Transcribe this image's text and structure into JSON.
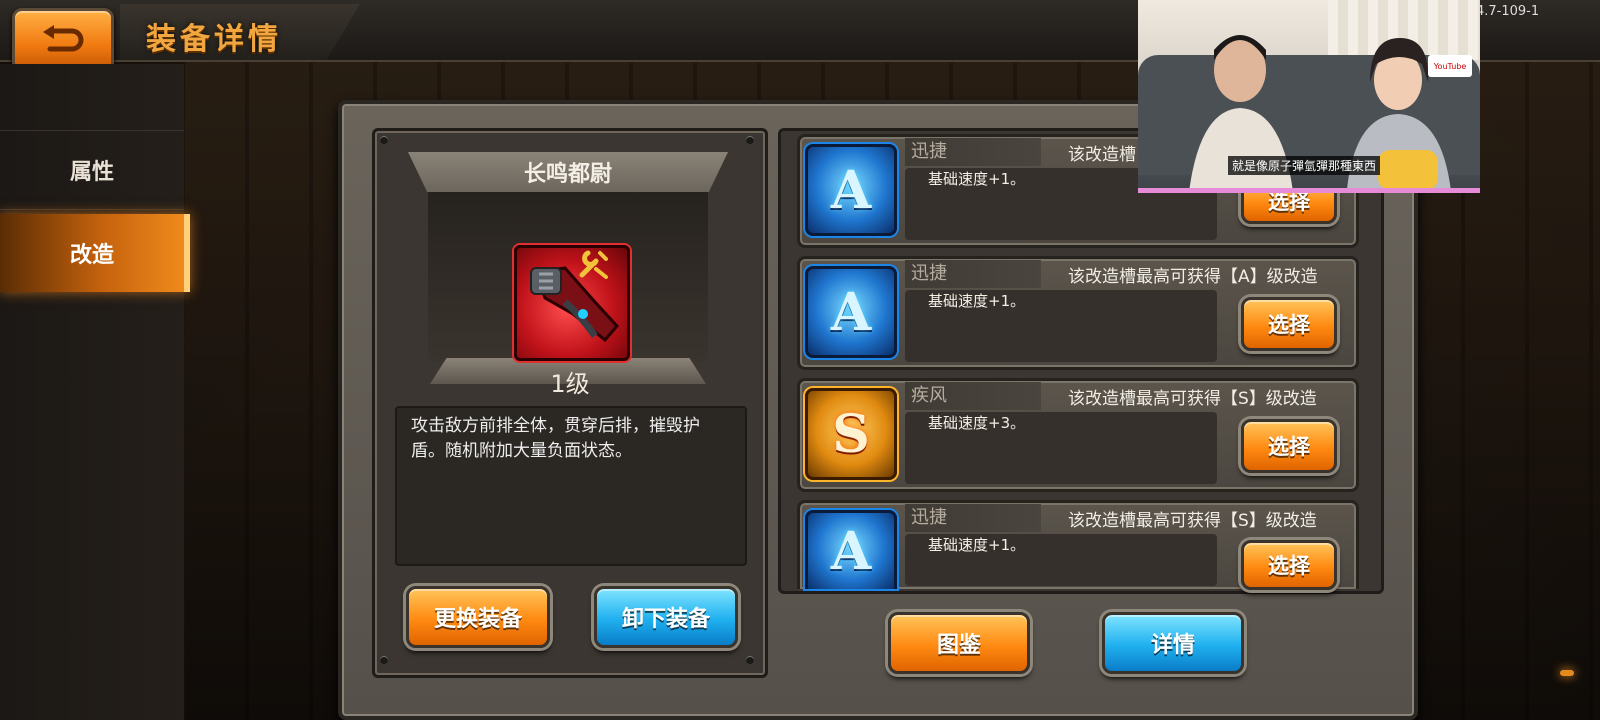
{
  "header": {
    "title": "装备详情",
    "version": "4.7-109-1"
  },
  "sidebar": {
    "items": [
      {
        "label": "属性",
        "active": false
      },
      {
        "label": "改造",
        "active": true
      }
    ]
  },
  "equipment": {
    "name": "长鸣都尉",
    "level": "1级",
    "description": "攻击敌方前排全体，贯穿后排，摧毁护盾。随机附加大量负面状态。",
    "icon": "mech-arm-icon",
    "buttons": {
      "replace": "更换装备",
      "unequip": "卸下装备"
    }
  },
  "slots": [
    {
      "grade": "A",
      "name": "迅捷",
      "limit": "该改造槽",
      "desc": "基础速度+1。",
      "button": "选择"
    },
    {
      "grade": "A",
      "name": "迅捷",
      "limit": "该改造槽最高可获得【A】级改造",
      "desc": "基础速度+1。",
      "button": "选择"
    },
    {
      "grade": "S",
      "name": "疾风",
      "limit": "该改造槽最高可获得【S】级改造",
      "desc": "基础速度+3。",
      "button": "选择"
    },
    {
      "grade": "A",
      "name": "迅捷",
      "limit": "该改造槽最高可获得【S】级改造",
      "desc": "基础速度+1。",
      "button": "选择"
    }
  ],
  "footer_buttons": {
    "codex": "图鉴",
    "details": "详情"
  },
  "webcam": {
    "caption": "就是像原子彈氫彈那種東西",
    "logo": "YouTube"
  },
  "colors": {
    "orange_accent": "#f08a1c",
    "blue_button": "#1fb0ef",
    "title_text": "#f2a640"
  }
}
